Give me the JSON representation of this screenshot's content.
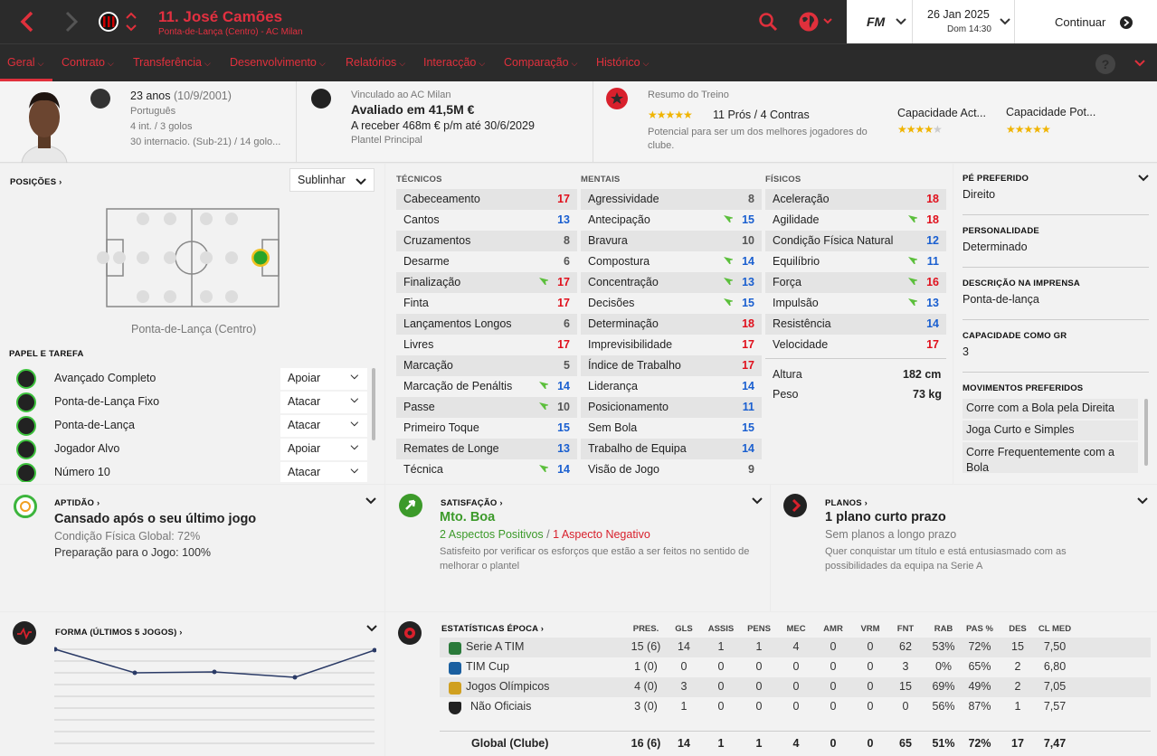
{
  "header": {
    "name": "11. José Camões",
    "subtitle": "Ponta-de-Lança (Centro) - AC Milan",
    "date": "26 Jan 2025",
    "day_time": "Dom 14:30",
    "continue": "Continuar",
    "fm": "FM"
  },
  "nav": [
    "Geral",
    "Contrato",
    "Transferência",
    "Desenvolvimento",
    "Relatórios",
    "Interacção",
    "Comparação",
    "Histórico"
  ],
  "profile": {
    "age": "23 anos",
    "dob": "(10/9/2001)",
    "nationality": "Português",
    "intl": "4 int. / 3 golos",
    "youth": "30 internacio. (Sub-21) / 14 golo...",
    "club_link": "Vinculado ao AC Milan",
    "value": "Avaliado em 41,5M €",
    "wage": "A receber 468m € p/m até 30/6/2029",
    "squad": "Plantel Principal",
    "training_label": "Resumo do Treino",
    "pros_cons": "11 Prós / 4 Contras",
    "potential_text": "Potencial para ser um dos melhores jogadores do clube.",
    "cap_act": "Capacidade Act...",
    "cap_pot": "Capacidade Pot...",
    "cap_act_stars": 4,
    "cap_pot_stars": 5,
    "training_stars": 5
  },
  "positions": {
    "title": "POSIÇÕES",
    "dropdown": "Sublinhar",
    "position_label": "Ponta-de-Lança (Centro)"
  },
  "roles": {
    "title": "PAPEL E TAREFA",
    "items": [
      {
        "name": "Avançado Completo",
        "duty": "Apoiar"
      },
      {
        "name": "Ponta-de-Lança Fixo",
        "duty": "Atacar"
      },
      {
        "name": "Ponta-de-Lança",
        "duty": "Atacar"
      },
      {
        "name": "Jogador Alvo",
        "duty": "Apoiar"
      },
      {
        "name": "Número 10",
        "duty": "Atacar"
      }
    ]
  },
  "attributes": {
    "tech_title": "TÉCNICOS",
    "mental_title": "MENTAIS",
    "phys_title": "FÍSICOS",
    "technical": [
      {
        "n": "Cabeceamento",
        "v": "17",
        "c": "red",
        "a": false
      },
      {
        "n": "Cantos",
        "v": "13",
        "c": "blue",
        "a": false
      },
      {
        "n": "Cruzamentos",
        "v": "8",
        "c": "gray",
        "a": false
      },
      {
        "n": "Desarme",
        "v": "6",
        "c": "gray",
        "a": false
      },
      {
        "n": "Finalização",
        "v": "17",
        "c": "red",
        "a": true
      },
      {
        "n": "Finta",
        "v": "17",
        "c": "red",
        "a": false
      },
      {
        "n": "Lançamentos Longos",
        "v": "6",
        "c": "gray",
        "a": false
      },
      {
        "n": "Livres",
        "v": "17",
        "c": "red",
        "a": false
      },
      {
        "n": "Marcação",
        "v": "5",
        "c": "gray",
        "a": false
      },
      {
        "n": "Marcação de Penáltis",
        "v": "14",
        "c": "blue",
        "a": true
      },
      {
        "n": "Passe",
        "v": "10",
        "c": "gray",
        "a": true
      },
      {
        "n": "Primeiro Toque",
        "v": "15",
        "c": "blue",
        "a": false
      },
      {
        "n": "Remates de Longe",
        "v": "13",
        "c": "blue",
        "a": false
      },
      {
        "n": "Técnica",
        "v": "14",
        "c": "blue",
        "a": true
      }
    ],
    "mental": [
      {
        "n": "Agressividade",
        "v": "8",
        "c": "gray",
        "a": false
      },
      {
        "n": "Antecipação",
        "v": "15",
        "c": "blue",
        "a": true
      },
      {
        "n": "Bravura",
        "v": "10",
        "c": "gray",
        "a": false
      },
      {
        "n": "Compostura",
        "v": "14",
        "c": "blue",
        "a": true
      },
      {
        "n": "Concentração",
        "v": "13",
        "c": "blue",
        "a": true
      },
      {
        "n": "Decisões",
        "v": "15",
        "c": "blue",
        "a": true
      },
      {
        "n": "Determinação",
        "v": "18",
        "c": "red",
        "a": false
      },
      {
        "n": "Imprevisibilidade",
        "v": "17",
        "c": "red",
        "a": false
      },
      {
        "n": "Índice de Trabalho",
        "v": "17",
        "c": "red",
        "a": false
      },
      {
        "n": "Liderança",
        "v": "14",
        "c": "blue",
        "a": false
      },
      {
        "n": "Posicionamento",
        "v": "11",
        "c": "blue",
        "a": false
      },
      {
        "n": "Sem Bola",
        "v": "15",
        "c": "blue",
        "a": false
      },
      {
        "n": "Trabalho de Equipa",
        "v": "14",
        "c": "blue",
        "a": false
      },
      {
        "n": "Visão de Jogo",
        "v": "9",
        "c": "gray",
        "a": false
      }
    ],
    "physical": [
      {
        "n": "Aceleração",
        "v": "18",
        "c": "red",
        "a": false
      },
      {
        "n": "Agilidade",
        "v": "18",
        "c": "red",
        "a": true
      },
      {
        "n": "Condição Física Natural",
        "v": "12",
        "c": "blue",
        "a": false
      },
      {
        "n": "Equilíbrio",
        "v": "11",
        "c": "blue",
        "a": true
      },
      {
        "n": "Força",
        "v": "16",
        "c": "red",
        "a": true
      },
      {
        "n": "Impulsão",
        "v": "13",
        "c": "blue",
        "a": true
      },
      {
        "n": "Resistência",
        "v": "14",
        "c": "blue",
        "a": false
      },
      {
        "n": "Velocidade",
        "v": "17",
        "c": "red",
        "a": false
      }
    ],
    "height_label": "Altura",
    "height": "182 cm",
    "weight_label": "Peso",
    "weight": "73 kg"
  },
  "side": {
    "foot_label": "PÉ PREFERIDO",
    "foot": "Direito",
    "pers_label": "PERSONALIDADE",
    "pers": "Determinado",
    "press_label": "DESCRIÇÃO NA IMPRENSA",
    "press": "Ponta-de-lança",
    "gk_label": "CAPACIDADE COMO GR",
    "gk": "3",
    "moves_label": "MOVIMENTOS PREFERIDOS",
    "moves": [
      "Corre com a Bola pela Direita",
      "Joga Curto e Simples",
      "Corre Frequentemente com a Bola"
    ]
  },
  "fitness": {
    "label": "APTIDÃO",
    "title": "Cansado após o seu último jogo",
    "line1": "Condição Física Global: 72%",
    "line2": "Preparação para o Jogo: 100%"
  },
  "satisfaction": {
    "label": "SATISFAÇÃO",
    "title": "Mto. Boa",
    "positive": "2 Aspectos Positivos",
    "sep": " / ",
    "negative": "1 Aspecto Negativo",
    "desc": "Satisfeito por verificar os esforços que estão a ser feitos no sentido de melhorar o plantel"
  },
  "plans": {
    "label": "PLANOS",
    "title": "1 plano curto prazo",
    "sub": "Sem planos a longo prazo",
    "desc": "Quer conquistar um título e está entusiasmado com as possibilidades da equipa na Serie A"
  },
  "form": {
    "label": "FORMA (ÚLTIMOS 5 JOGOS)"
  },
  "stats": {
    "label": "ESTATÍSTICAS ÉPOCA",
    "headers": [
      "PRES.",
      "GLS",
      "ASSIS",
      "PENS",
      "MEC",
      "AMR",
      "VRM",
      "FNT",
      "RAB",
      "PAS %",
      "DES",
      "CL MED"
    ],
    "rows": [
      {
        "comp": "Serie A TIM",
        "vals": [
          "15 (6)",
          "14",
          "1",
          "1",
          "4",
          "0",
          "0",
          "62",
          "53%",
          "72%",
          "15",
          "7,50"
        ]
      },
      {
        "comp": "TIM Cup",
        "vals": [
          "1 (0)",
          "0",
          "0",
          "0",
          "0",
          "0",
          "0",
          "3",
          "0%",
          "65%",
          "2",
          "6,80"
        ]
      },
      {
        "comp": "Jogos Olímpicos",
        "vals": [
          "4 (0)",
          "3",
          "0",
          "0",
          "0",
          "0",
          "0",
          "15",
          "69%",
          "49%",
          "2",
          "7,05"
        ]
      },
      {
        "comp": "Não Oficiais",
        "vals": [
          "3 (0)",
          "1",
          "0",
          "0",
          "0",
          "0",
          "0",
          "0",
          "56%",
          "87%",
          "1",
          "7,57"
        ]
      }
    ],
    "total": {
      "comp": "Global (Clube)",
      "vals": [
        "16 (6)",
        "14",
        "1",
        "1",
        "4",
        "0",
        "0",
        "65",
        "51%",
        "72%",
        "17",
        "7,47"
      ]
    }
  }
}
